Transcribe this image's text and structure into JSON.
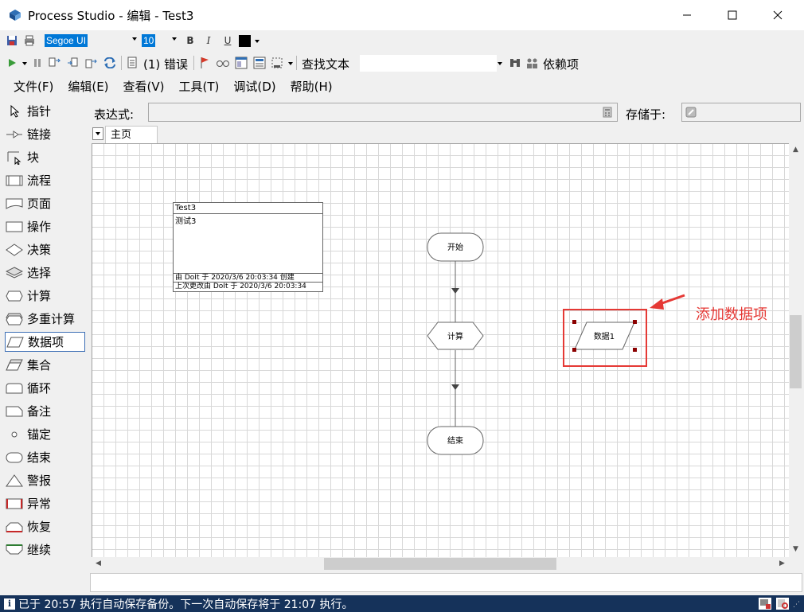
{
  "window": {
    "title": "Process Studio  - 编辑 - Test3"
  },
  "toolbar1": {
    "font_name": "Segoe UI",
    "font_size": "10",
    "bold_label": "B",
    "italic_label": "I",
    "underline_label": "U",
    "text_color": "#000000"
  },
  "toolbar2": {
    "errors_label": "(1) 错误",
    "find_label": "查找文本",
    "find_value": "",
    "dependencies_label": "依赖项"
  },
  "menu": {
    "items": [
      "文件(F)",
      "编辑(E)",
      "查看(V)",
      "工具(T)",
      "调试(D)",
      "帮助(H)"
    ]
  },
  "palette": {
    "items": [
      {
        "label": "指针",
        "icon": "pointer-icon"
      },
      {
        "label": "链接",
        "icon": "link-icon"
      },
      {
        "label": "块",
        "icon": "block-icon"
      },
      {
        "label": "流程",
        "icon": "process-icon"
      },
      {
        "label": "页面",
        "icon": "page-icon"
      },
      {
        "label": "操作",
        "icon": "action-icon"
      },
      {
        "label": "决策",
        "icon": "decision-icon"
      },
      {
        "label": "选择",
        "icon": "choice-icon"
      },
      {
        "label": "计算",
        "icon": "calculation-icon"
      },
      {
        "label": "多重计算",
        "icon": "multi-calculation-icon"
      },
      {
        "label": "数据项",
        "icon": "data-item-icon"
      },
      {
        "label": "集合",
        "icon": "collection-icon"
      },
      {
        "label": "循环",
        "icon": "loop-icon"
      },
      {
        "label": "备注",
        "icon": "note-icon"
      },
      {
        "label": "锚定",
        "icon": "anchor-icon"
      },
      {
        "label": "结束",
        "icon": "end-icon"
      },
      {
        "label": "警报",
        "icon": "alert-icon"
      },
      {
        "label": "异常",
        "icon": "exception-icon"
      },
      {
        "label": "恢复",
        "icon": "recover-icon"
      },
      {
        "label": "继续",
        "icon": "resume-icon"
      }
    ],
    "selected_index": 10
  },
  "expression_bar": {
    "expression_label": "表达式:",
    "expression_value": "",
    "store_label": "存储于:",
    "store_value": ""
  },
  "tabs": {
    "active": "主页"
  },
  "canvas": {
    "info_box": {
      "name": "Test3",
      "description": "测试3",
      "created": "由 DoIt 于 2020/3/6  20:03:34 创建",
      "modified": "上次更改由 DoIt 于 2020/3/6 20:03:34"
    },
    "stages": {
      "start": "开始",
      "calc": "计算",
      "end": "结束",
      "data": "数据1"
    }
  },
  "annotation": {
    "text": "添加数据项",
    "color": "#e53935"
  },
  "status": {
    "message": "已于 20:57 执行自动保存备份。下一次自动保存将于 21:07 执行。"
  },
  "colors": {
    "status_bg": "#15325a",
    "selection_blue": "#0078d7",
    "annotation_red": "#e53935",
    "handle_red": "#8b0000"
  }
}
